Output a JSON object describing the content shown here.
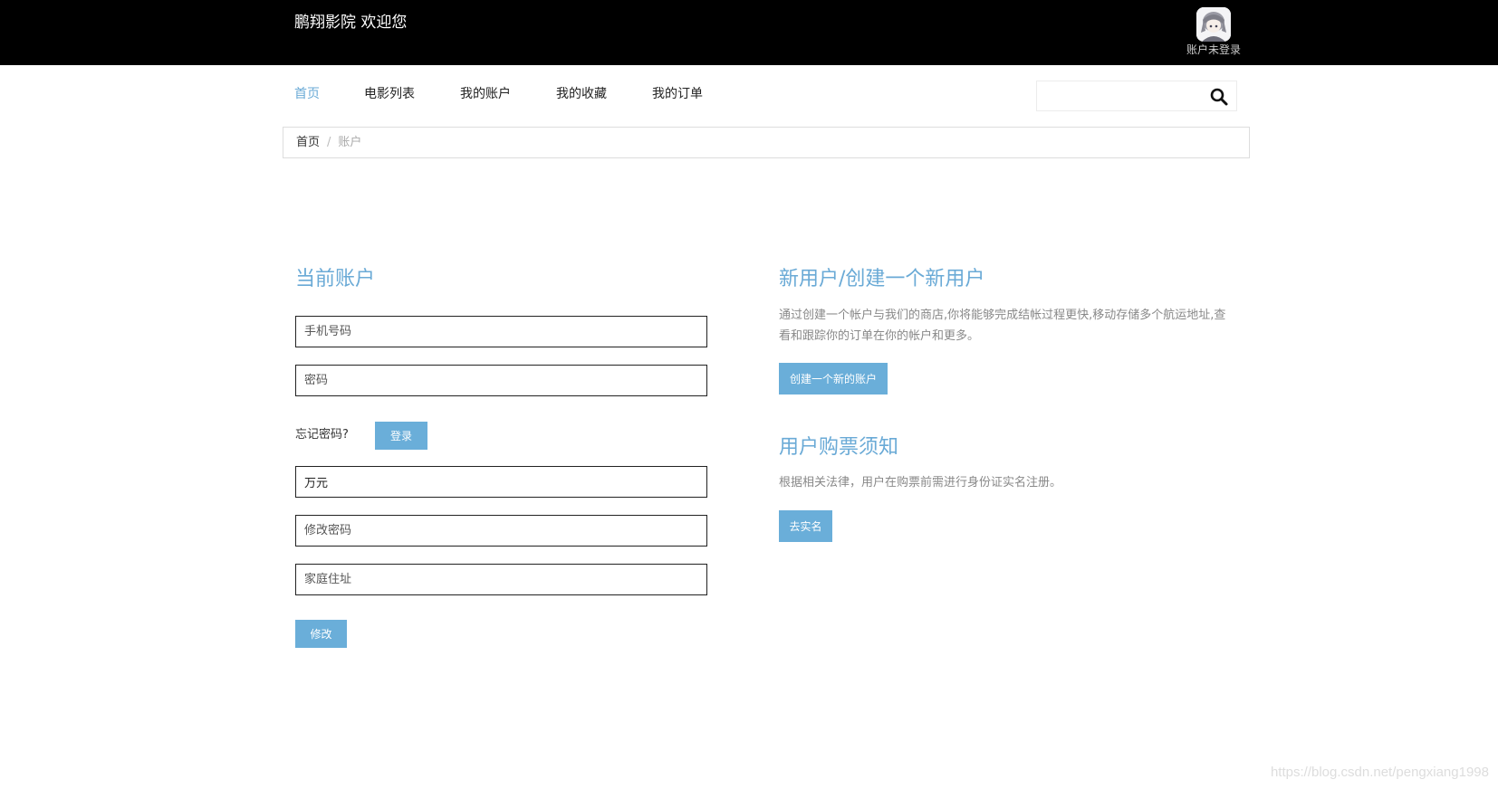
{
  "header": {
    "site_title": "鹏翔影院 欢迎您",
    "account_status": "账户未登录",
    "avatar_icon": "anime-avatar-icon"
  },
  "nav": {
    "items": [
      {
        "label": "首页",
        "active": true
      },
      {
        "label": "电影列表",
        "active": false
      },
      {
        "label": "我的账户",
        "active": false
      },
      {
        "label": "我的收藏",
        "active": false
      },
      {
        "label": "我的订单",
        "active": false
      }
    ]
  },
  "search": {
    "placeholder": "",
    "icon": "search-icon"
  },
  "breadcrumb": {
    "home": "首页",
    "separator": "/",
    "current": "账户"
  },
  "login": {
    "title": "当前账户",
    "phone_placeholder": "手机号码",
    "password_placeholder": "密码",
    "forgot_label": "忘记密码?",
    "login_button": "登录",
    "name_value": "万元",
    "new_password_placeholder": "修改密码",
    "address_placeholder": "家庭住址",
    "modify_button": "修改"
  },
  "register": {
    "title": "新用户/创建一个新用户",
    "description": "通过创建一个帐户与我们的商店,你将能够完成结帐过程更快,移动存储多个航运地址,查看和跟踪你的订单在你的帐户和更多。",
    "create_button": "创建一个新的账户"
  },
  "notice": {
    "title": "用户购票须知",
    "description": "根据相关法律，用户在购票前需进行身份证实名注册。",
    "verify_button": "去实名"
  },
  "watermark": "https://blog.csdn.net/pengxiang1998",
  "colors": {
    "accent": "#6aaad6",
    "header_bg": "#000000",
    "button_bg": "#6aaed9"
  }
}
